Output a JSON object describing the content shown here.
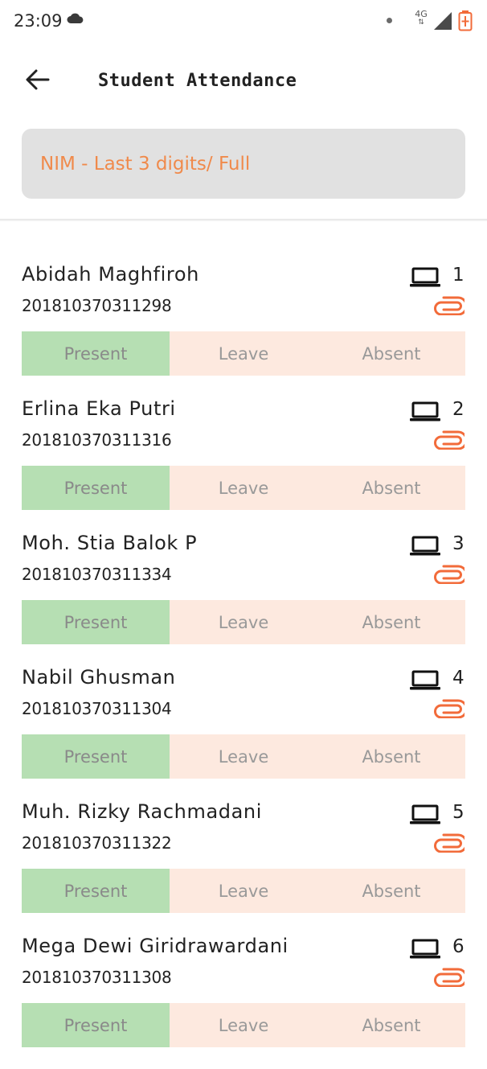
{
  "status_bar": {
    "time": "23:09",
    "network": "4G"
  },
  "header": {
    "title": "Student Attendance"
  },
  "search": {
    "placeholder": "NIM - Last 3 digits/ Full"
  },
  "options": {
    "present": "Present",
    "leave": "Leave",
    "absent": "Absent"
  },
  "students": [
    {
      "name": "Abidah Maghfiroh",
      "nim": "201810370311298",
      "number": "1"
    },
    {
      "name": "Erlina Eka Putri",
      "nim": "201810370311316",
      "number": "2"
    },
    {
      "name": "Moh. Stia Balok P",
      "nim": "201810370311334",
      "number": "3"
    },
    {
      "name": "Nabil Ghusman",
      "nim": "201810370311304",
      "number": "4"
    },
    {
      "name": "Muh. Rizky Rachmadani",
      "nim": "201810370311322",
      "number": "5"
    },
    {
      "name": "Mega Dewi Giridrawardani",
      "nim": "201810370311308",
      "number": "6"
    }
  ],
  "colors": {
    "accent": "#f08a4b",
    "present_bg": "#b6dfb3",
    "other_bg": "#fde9df",
    "clip": "#f26b3a"
  },
  "icons": {
    "back": "arrow-left-icon",
    "device": "laptop-icon",
    "attachment": "paperclip-icon"
  }
}
